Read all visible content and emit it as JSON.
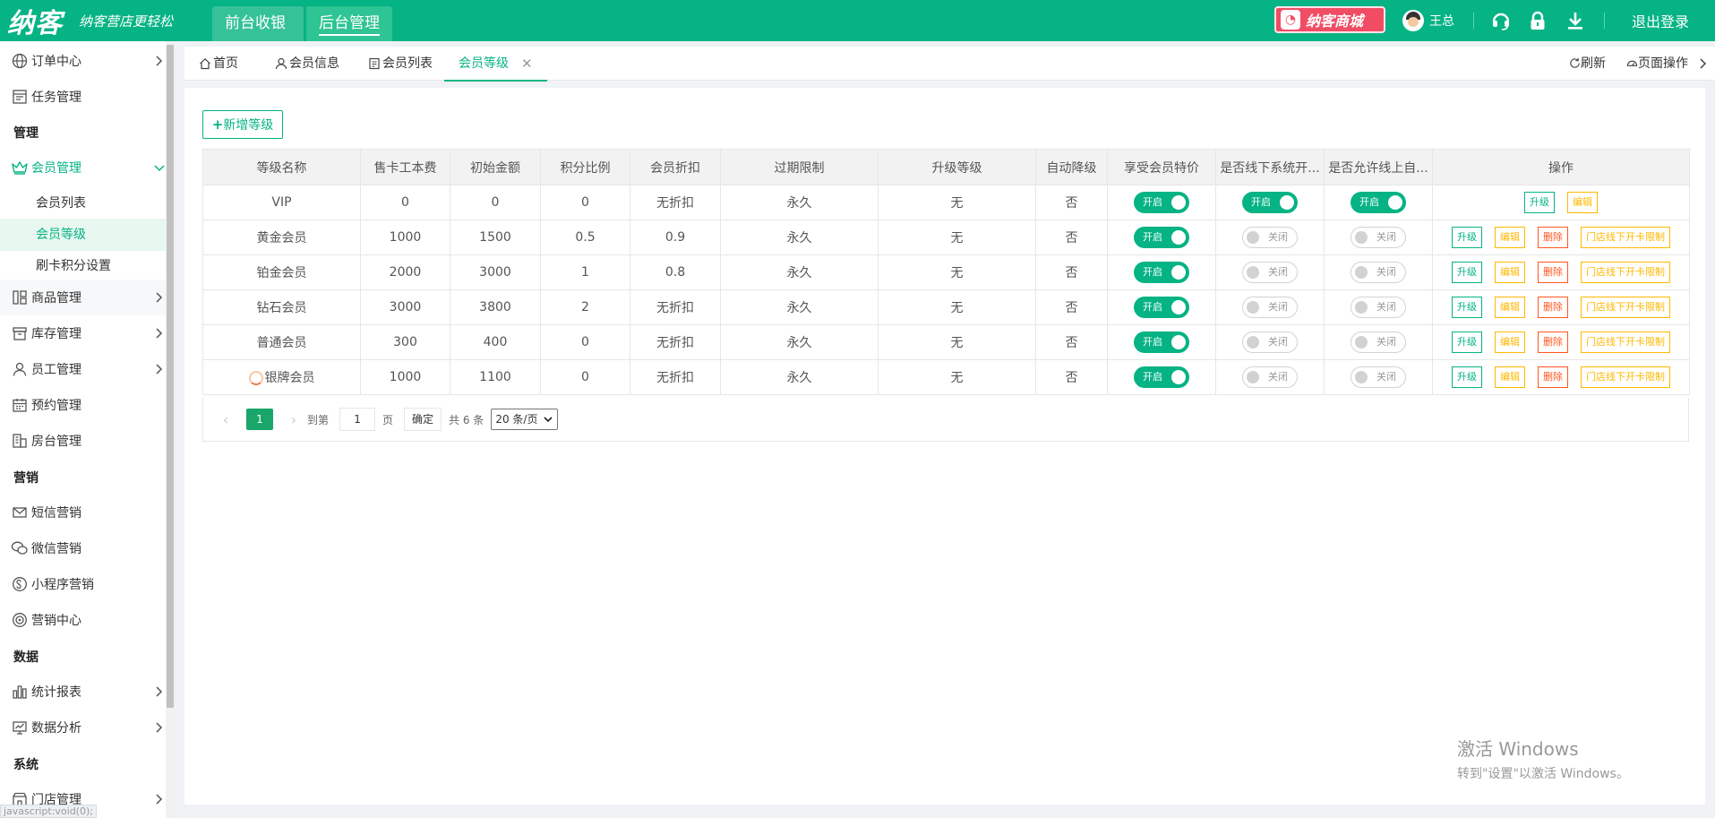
{
  "brand": {
    "logo": "纳客",
    "slogan": "纳客营店更轻松"
  },
  "top_tabs": [
    "前台收银",
    "后台管理"
  ],
  "mall": "纳客商城",
  "user": {
    "name": "王总"
  },
  "logout": "退出登录",
  "sidebar": {
    "items": [
      {
        "label": "订单中心",
        "icon": "globe-icon",
        "arrow": true
      },
      {
        "label": "任务管理",
        "icon": "task-icon",
        "arrow": false
      }
    ],
    "group_manage": "管理",
    "member": {
      "label": "会员管理",
      "icon": "crown-icon"
    },
    "member_subs": [
      "会员列表",
      "会员等级",
      "刷卡积分设置"
    ],
    "items2": [
      {
        "label": "商品管理",
        "icon": "goods-icon"
      },
      {
        "label": "库存管理",
        "icon": "inventory-icon"
      },
      {
        "label": "员工管理",
        "icon": "staff-icon"
      },
      {
        "label": "预约管理",
        "icon": "calendar-icon"
      },
      {
        "label": "房台管理",
        "icon": "building-icon"
      }
    ],
    "group_marketing": "营销",
    "marketing": [
      {
        "label": "短信营销",
        "icon": "mail-icon"
      },
      {
        "label": "微信营销",
        "icon": "wechat-icon"
      },
      {
        "label": "小程序营销",
        "icon": "miniprogram-icon"
      },
      {
        "label": "营销中心",
        "icon": "target-icon"
      }
    ],
    "group_data": "数据",
    "data": [
      {
        "label": "统计报表",
        "icon": "bar-chart-icon"
      },
      {
        "label": "数据分析",
        "icon": "analysis-icon"
      }
    ],
    "group_system": "系统",
    "system": [
      {
        "label": "门店管理",
        "icon": "store-icon"
      }
    ]
  },
  "status_url": "javascript:void(0);",
  "page_tabs": [
    {
      "label": "首页",
      "icon": "home-icon"
    },
    {
      "label": "会员信息",
      "icon": "user-icon"
    },
    {
      "label": "会员列表",
      "icon": "list-icon"
    },
    {
      "label": "会员等级",
      "active": true
    }
  ],
  "tab_tools": {
    "refresh": "刷新",
    "page_ops": "页面操作"
  },
  "add_button": "新增等级",
  "table": {
    "headers": [
      "等级名称",
      "售卡工本费",
      "初始金额",
      "积分比例",
      "会员折扣",
      "过期限制",
      "升级等级",
      "自动降级",
      "享受会员特价",
      "是否线下系统开...",
      "是否允许线上自...",
      "操作"
    ],
    "rows": [
      {
        "name": "VIP",
        "fee": "0",
        "init": "0",
        "ratio": "0",
        "discount": "无折扣",
        "expire": "永久",
        "upgrade": "无",
        "auto_down": "否",
        "special": "开启",
        "offline": "开启",
        "online": "开启",
        "ops": [
          "升级",
          "编辑"
        ]
      },
      {
        "name": "黄金会员",
        "fee": "1000",
        "init": "1500",
        "ratio": "0.5",
        "discount": "0.9",
        "expire": "永久",
        "upgrade": "无",
        "auto_down": "否",
        "special": "开启",
        "offline": "关闭",
        "online": "关闭",
        "ops": [
          "升级",
          "编辑",
          "删除",
          "门店线下开卡限制"
        ]
      },
      {
        "name": "铂金会员",
        "fee": "2000",
        "init": "3000",
        "ratio": "1",
        "discount": "0.8",
        "expire": "永久",
        "upgrade": "无",
        "auto_down": "否",
        "special": "开启",
        "offline": "关闭",
        "online": "关闭",
        "ops": [
          "升级",
          "编辑",
          "删除",
          "门店线下开卡限制"
        ]
      },
      {
        "name": "钻石会员",
        "fee": "3000",
        "init": "3800",
        "ratio": "2",
        "discount": "无折扣",
        "expire": "永久",
        "upgrade": "无",
        "auto_down": "否",
        "special": "开启",
        "offline": "关闭",
        "online": "关闭",
        "ops": [
          "升级",
          "编辑",
          "删除",
          "门店线下开卡限制"
        ]
      },
      {
        "name": "普通会员",
        "fee": "300",
        "init": "400",
        "ratio": "0",
        "discount": "无折扣",
        "expire": "永久",
        "upgrade": "无",
        "auto_down": "否",
        "special": "开启",
        "offline": "关闭",
        "online": "关闭",
        "ops": [
          "升级",
          "编辑",
          "删除",
          "门店线下开卡限制"
        ]
      },
      {
        "name": "银牌会员",
        "fee": "1000",
        "init": "1100",
        "ratio": "0",
        "discount": "无折扣",
        "expire": "永久",
        "upgrade": "无",
        "auto_down": "否",
        "special": "开启",
        "offline": "关闭",
        "online": "关闭",
        "ops": [
          "升级",
          "编辑",
          "删除",
          "门店线下开卡限制"
        ],
        "loading": true
      }
    ]
  },
  "pager": {
    "current": "1",
    "goto_label": "到第",
    "goto_value": "1",
    "page_unit": "页",
    "confirm": "确定",
    "total": "共 6 条",
    "page_size": "20 条/页"
  },
  "watermark": {
    "line1": "激活 Windows",
    "line2": "转到\"设置\"以激活 Windows。"
  },
  "colors": {
    "primary": "#05b384",
    "warning": "#ffb800",
    "danger": "#ff5722",
    "mall": "#f04d64"
  }
}
